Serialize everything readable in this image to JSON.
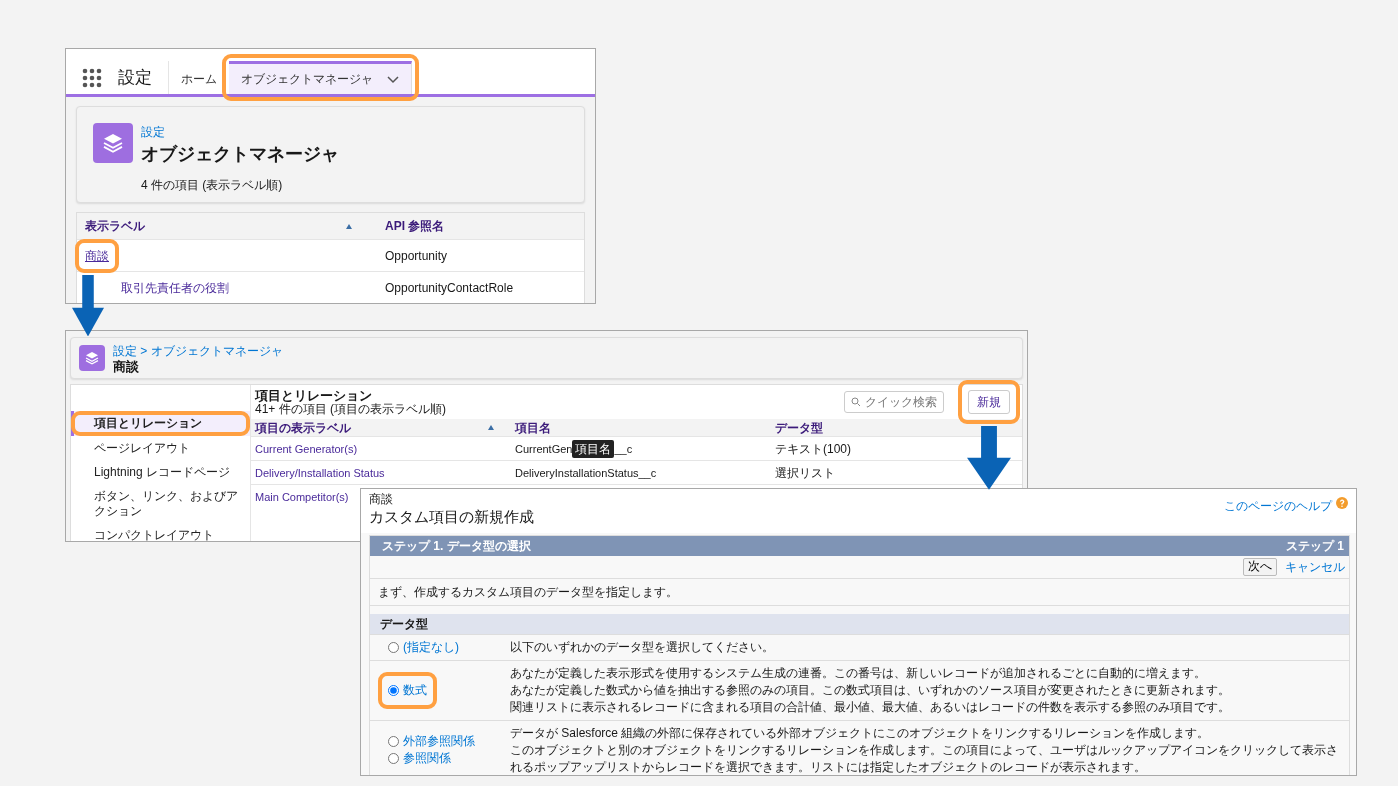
{
  "setup_panel": {
    "nav": {
      "title": "設定",
      "tabs": [
        {
          "label": "ホーム",
          "selected": false,
          "has_menu": false
        },
        {
          "label": "オブジェクトマネージャ",
          "selected": true,
          "has_menu": true
        }
      ]
    },
    "header": {
      "breadcrumb": "設定",
      "title": "オブジェクトマネージャ",
      "subtitle": "4 件の項目 (表示ラベル順)"
    },
    "table": {
      "columns": [
        {
          "label": "表示ラベル",
          "sorted": true
        },
        {
          "label": "API 参照名",
          "sorted": false
        }
      ],
      "rows": [
        {
          "label": "商談",
          "api_name": "Opportunity"
        },
        {
          "label": "取引先責任者の役割",
          "api_name": "OpportunityContactRole"
        }
      ]
    }
  },
  "object_panel": {
    "breadcrumb": "設定 > オブジェクトマネージャ",
    "title": "商談",
    "sidebar": [
      {
        "label": "項目とリレーション",
        "selected": true
      },
      {
        "label": "ページレイアウト",
        "selected": false
      },
      {
        "label": "Lightning レコードページ",
        "selected": false
      },
      {
        "label": "ボタン、リンク、およびアクション",
        "selected": false
      },
      {
        "label": "コンパクトレイアウト",
        "selected": false
      }
    ],
    "section_title": "項目とリレーション",
    "section_subtitle": "41+ 件の項目 (項目の表示ラベル順)",
    "search": {
      "placeholder": "クイック検索"
    },
    "new_button": "新規",
    "columns": [
      {
        "label": "項目の表示ラベル",
        "sorted": true
      },
      {
        "label": "項目名",
        "sorted": false
      },
      {
        "label": "データ型",
        "sorted": false
      }
    ],
    "rows": [
      {
        "label": "Current Generator(s)",
        "api_name": "CurrentGen",
        "tooltip": "項目名",
        "api_name_end": "__c",
        "data_type": "テキスト(100)"
      },
      {
        "label": "Delivery/Installation Status",
        "api_name": "DeliveryInstallationStatus__c",
        "data_type": "選択リスト"
      },
      {
        "label": "Main Competitor(s)"
      }
    ]
  },
  "new_field_panel": {
    "object": "商談",
    "title": "カスタム項目の新規作成",
    "help": "このページのヘルプ",
    "step_title": "ステップ 1. データ型の選択",
    "step": "ステップ 1",
    "buttons": [
      {
        "label": "次へ",
        "kind": "button"
      },
      {
        "label": "キャンセル",
        "kind": "link"
      }
    ],
    "intro": "まず、作成するカスタム項目のデータ型を指定します。",
    "section": "データ型",
    "groups": [
      [
        {
          "label": "(指定なし)",
          "checked": false,
          "description": "以下のいずれかのデータ型を選択してください。"
        }
      ],
      [
        {
          "description": "あなたが定義した表示形式を使用するシステム生成の連番。この番号は、新しいレコードが追加されるごとに自動的に増えます。"
        },
        {
          "label": "数式",
          "checked": true,
          "description": "あなたが定義した数式から値を抽出する参照のみの項目。この数式項目は、いずれかのソース項目が変更されたときに更新されます。"
        },
        {
          "description": "関連リストに表示されるレコードに含まれる項目の合計値、最小値、最大値、あるいはレコードの件数を表示する参照のみ項目です。"
        }
      ],
      [
        {
          "label": "外部参照関係",
          "checked": false,
          "description": "データが Salesforce 組織の外部に保存されている外部オブジェクトにこのオブジェクトをリンクするリレーションを作成します。"
        },
        {
          "label": "参照関係",
          "checked": false,
          "description": "このオブジェクトと別のオブジェクトをリンクするリレーションを作成します。この項目によって、ユーザはルックアップアイコンをクリックして表示されるポップアップリストからレコードを選択できます。リストには指定したオブジェクトのレコードが表示されます。"
        }
      ]
    ]
  }
}
